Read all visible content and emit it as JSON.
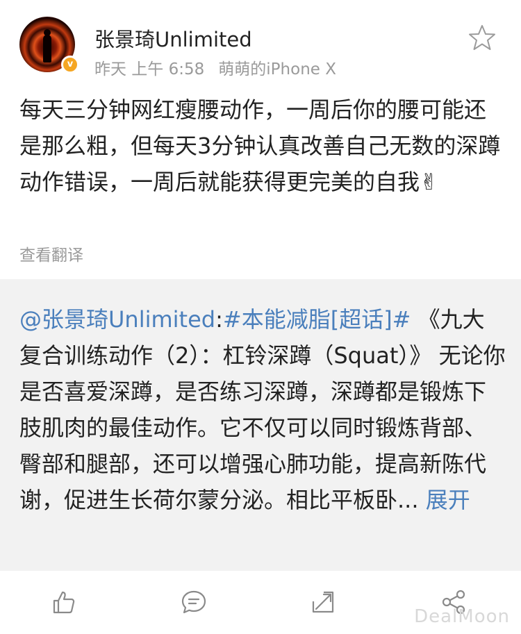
{
  "post": {
    "username": "张景琦Unlimited",
    "verified_badge": "v",
    "time": "昨天 上午 6:58",
    "source": "萌萌的iPhone X",
    "text": "每天三分钟网红瘦腰动作，一周后你的腰可能还是那么粗，但每天3分钟认真改善自己无数的深蹲动作错误，一周后就能获得更完美的自我",
    "emoji": "✌",
    "translate_label": "查看翻译"
  },
  "repost": {
    "mention": "@张景琦Unlimited",
    "colon": ":",
    "topic": "#本能减脂[超话]#",
    "body": " 《九大复合训练动作（2）：杠铃深蹲（Squat）》 无论你是否喜爱深蹲，是否练习深蹲，深蹲都是锻炼下肢肌肉的最佳动作。它不仅可以同时锻炼背部、臀部和腿部，还可以增强心肺功能，提高新陈代谢，促进生长荷尔蒙分泌。相比平板卧...",
    "expand_label": "展开"
  },
  "icons": {
    "favorite": "star-icon",
    "like": "thumbs-up-icon",
    "comment": "comment-icon",
    "share": "share-icon",
    "forward": "forward-icon"
  },
  "watermark": "DealMoon",
  "colors": {
    "link": "#4a7fbc",
    "meta": "#9a9a9a",
    "repost_bg": "#f2f2f2",
    "badge": "#f5a623"
  }
}
